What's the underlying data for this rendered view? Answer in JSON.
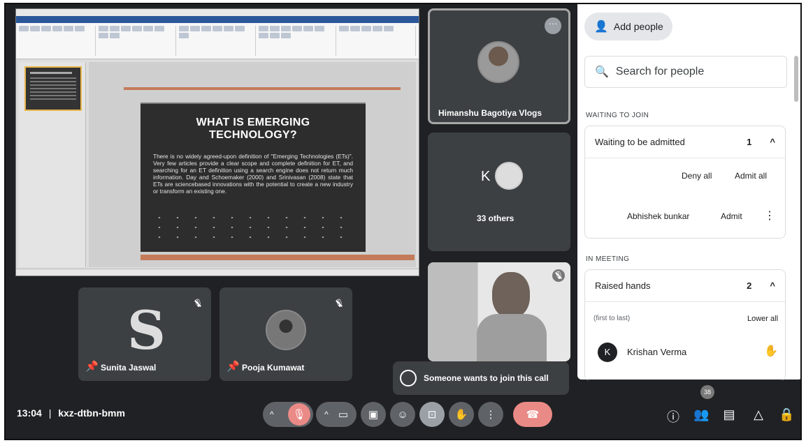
{
  "presentation": {
    "slide_title": "WHAT IS EMERGING TECHNOLOGY?",
    "slide_body": "There is no widely agreed-upon definition of \"Emerging Technologies (ETs)\". Very few articles provide a clear scope and complete definition for ET, and searching for an ET definition using a search engine does not return much information. Day and Schoemaker (2000) and Srinivasan (2008) state that ETs are sciencebased innovations with the potential to create a new industry or transform an existing one."
  },
  "tiles": {
    "himanshu_name": "Himanshu Bagotiya Vlogs",
    "others_initial": "K",
    "others_label": "33 others",
    "sunita_name": "Sunita Jaswal",
    "pooja_name": "Pooja Kumawat"
  },
  "toast": {
    "text": "Someone wants to join this call"
  },
  "meeting": {
    "time": "13:04",
    "separator": "|",
    "code": "kxz-dtbn-bmm"
  },
  "controls": {
    "people_count": "38"
  },
  "panel": {
    "add_people": "Add people",
    "search_placeholder": "Search for people",
    "waiting_section": "WAITING TO JOIN",
    "waiting_title": "Waiting to be admitted",
    "waiting_count": "1",
    "deny_all": "Deny all",
    "admit_all": "Admit all",
    "waiting_person": "Abhishek bunkar",
    "admit": "Admit",
    "in_meeting_section": "IN MEETING",
    "raised_title": "Raised hands",
    "raised_count": "2",
    "order_label": "(first to last)",
    "lower_all": "Lower all",
    "raised_person": "Krishan Verma",
    "raised_initial": "K"
  },
  "icons": [
    "mic-off-icon",
    "video-icon",
    "captions-icon",
    "emoji-icon",
    "present-icon",
    "hand-icon",
    "more-icon",
    "end-call-icon",
    "info-icon",
    "people-icon",
    "chat-icon",
    "activities-icon",
    "host-controls-icon",
    "search-icon",
    "add-person-icon",
    "pin-icon"
  ]
}
